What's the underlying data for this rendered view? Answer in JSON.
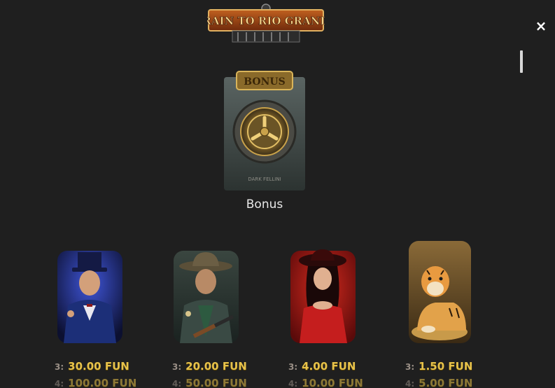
{
  "header": {
    "logo_text": "TRAIN TO RIO GRANDE",
    "close_label": "×"
  },
  "bonus": {
    "badge_text": "BONUS",
    "vendor_text": "DARK FELLINI",
    "label": "Bonus"
  },
  "symbols": [
    {
      "name": "gentleman",
      "pays": [
        {
          "count": "3:",
          "value": "30.00 FUN"
        },
        {
          "count": "4:",
          "value": "100.00 FUN"
        }
      ]
    },
    {
      "name": "sheriff",
      "pays": [
        {
          "count": "3:",
          "value": "20.00 FUN"
        },
        {
          "count": "4:",
          "value": "50.00 FUN"
        }
      ]
    },
    {
      "name": "lady",
      "pays": [
        {
          "count": "3:",
          "value": "4.00 FUN"
        },
        {
          "count": "4:",
          "value": "10.00 FUN"
        }
      ]
    },
    {
      "name": "tiger",
      "pays": [
        {
          "count": "3:",
          "value": "1.50 FUN"
        },
        {
          "count": "4:",
          "value": "5.00 FUN"
        }
      ]
    }
  ],
  "colors": {
    "background": "#1f1f1f",
    "payout_gold": "#e7c24a",
    "label_text": "#e8e8e8"
  }
}
